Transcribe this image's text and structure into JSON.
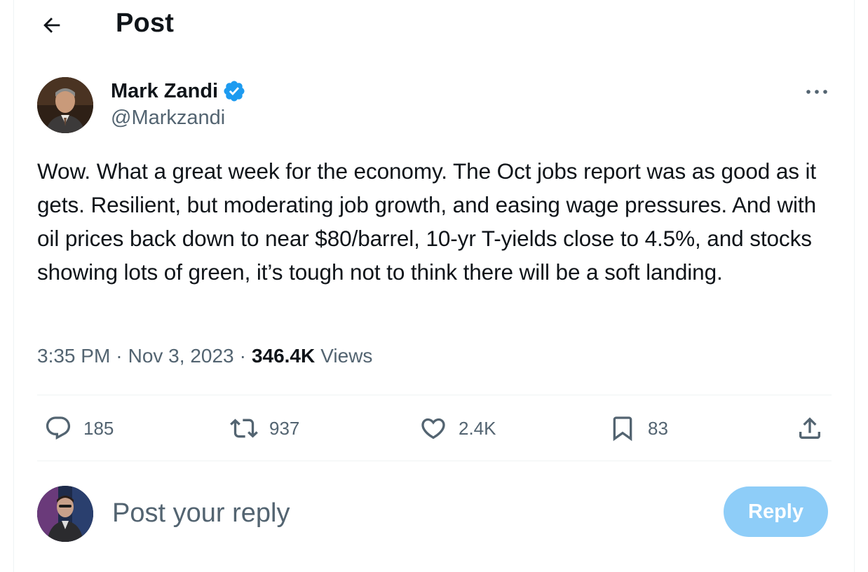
{
  "header": {
    "title": "Post",
    "back_icon": "arrow-left-icon"
  },
  "author": {
    "name": "Mark Zandi",
    "handle": "@Markzandi",
    "verified": true,
    "verified_color": "#1d9bf0",
    "more_icon": "more-horizontal-icon"
  },
  "tweet": {
    "text": "Wow. What a great week for the economy. The Oct jobs report was as good as it gets. Resilient, but moderating job growth, and easing wage pressures. And with oil prices back down to near $80/barrel, 10-yr T-yields close to 4.5%, and stocks showing lots of green, it’s tough not to think there will be a soft landing.",
    "time": "3:35 PM",
    "date": "Nov 3, 2023",
    "separator": "·",
    "views_count": "346.4K",
    "views_label": "Views"
  },
  "actions": {
    "replies": "185",
    "reposts": "937",
    "likes": "2.4K",
    "bookmarks": "83"
  },
  "reply": {
    "placeholder": "Post your reply",
    "button_label": "Reply",
    "button_color": "#8ecdf8"
  },
  "colors": {
    "text": "#0f1419",
    "secondary": "#536471",
    "divider": "#eff3f4"
  }
}
